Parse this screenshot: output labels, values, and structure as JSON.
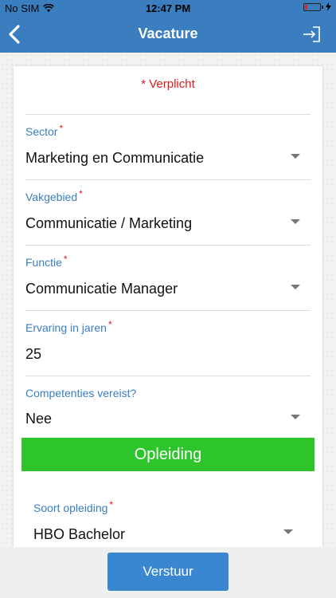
{
  "status_bar": {
    "carrier": "No SIM",
    "time": "12:47 PM"
  },
  "nav": {
    "title": "Vacature",
    "back_icon": "chevron-left-icon",
    "logout_icon": "logout-icon"
  },
  "form": {
    "required_note": "* Verplicht",
    "fields": [
      {
        "label": "Sector",
        "required": "*",
        "value": "Marketing en Communicatie"
      },
      {
        "label": "Vakgebied",
        "required": "*",
        "value": "Communicatie / Marketing"
      },
      {
        "label": "Functie",
        "required": "*",
        "value": "Communicatie Manager"
      },
      {
        "label": "Ervaring in jaren",
        "required": "*",
        "value": "25"
      },
      {
        "label": "Competenties vereist?",
        "value": "Nee"
      }
    ],
    "section_title": "Opleiding",
    "education": {
      "label": "Soort opleiding",
      "required": "*",
      "value": "HBO Bachelor"
    }
  },
  "submit_label": "Verstuur",
  "colors": {
    "accent": "#3a7ebf",
    "required": "#e0191e",
    "section": "#2ec52c",
    "button": "#3a86d0"
  }
}
